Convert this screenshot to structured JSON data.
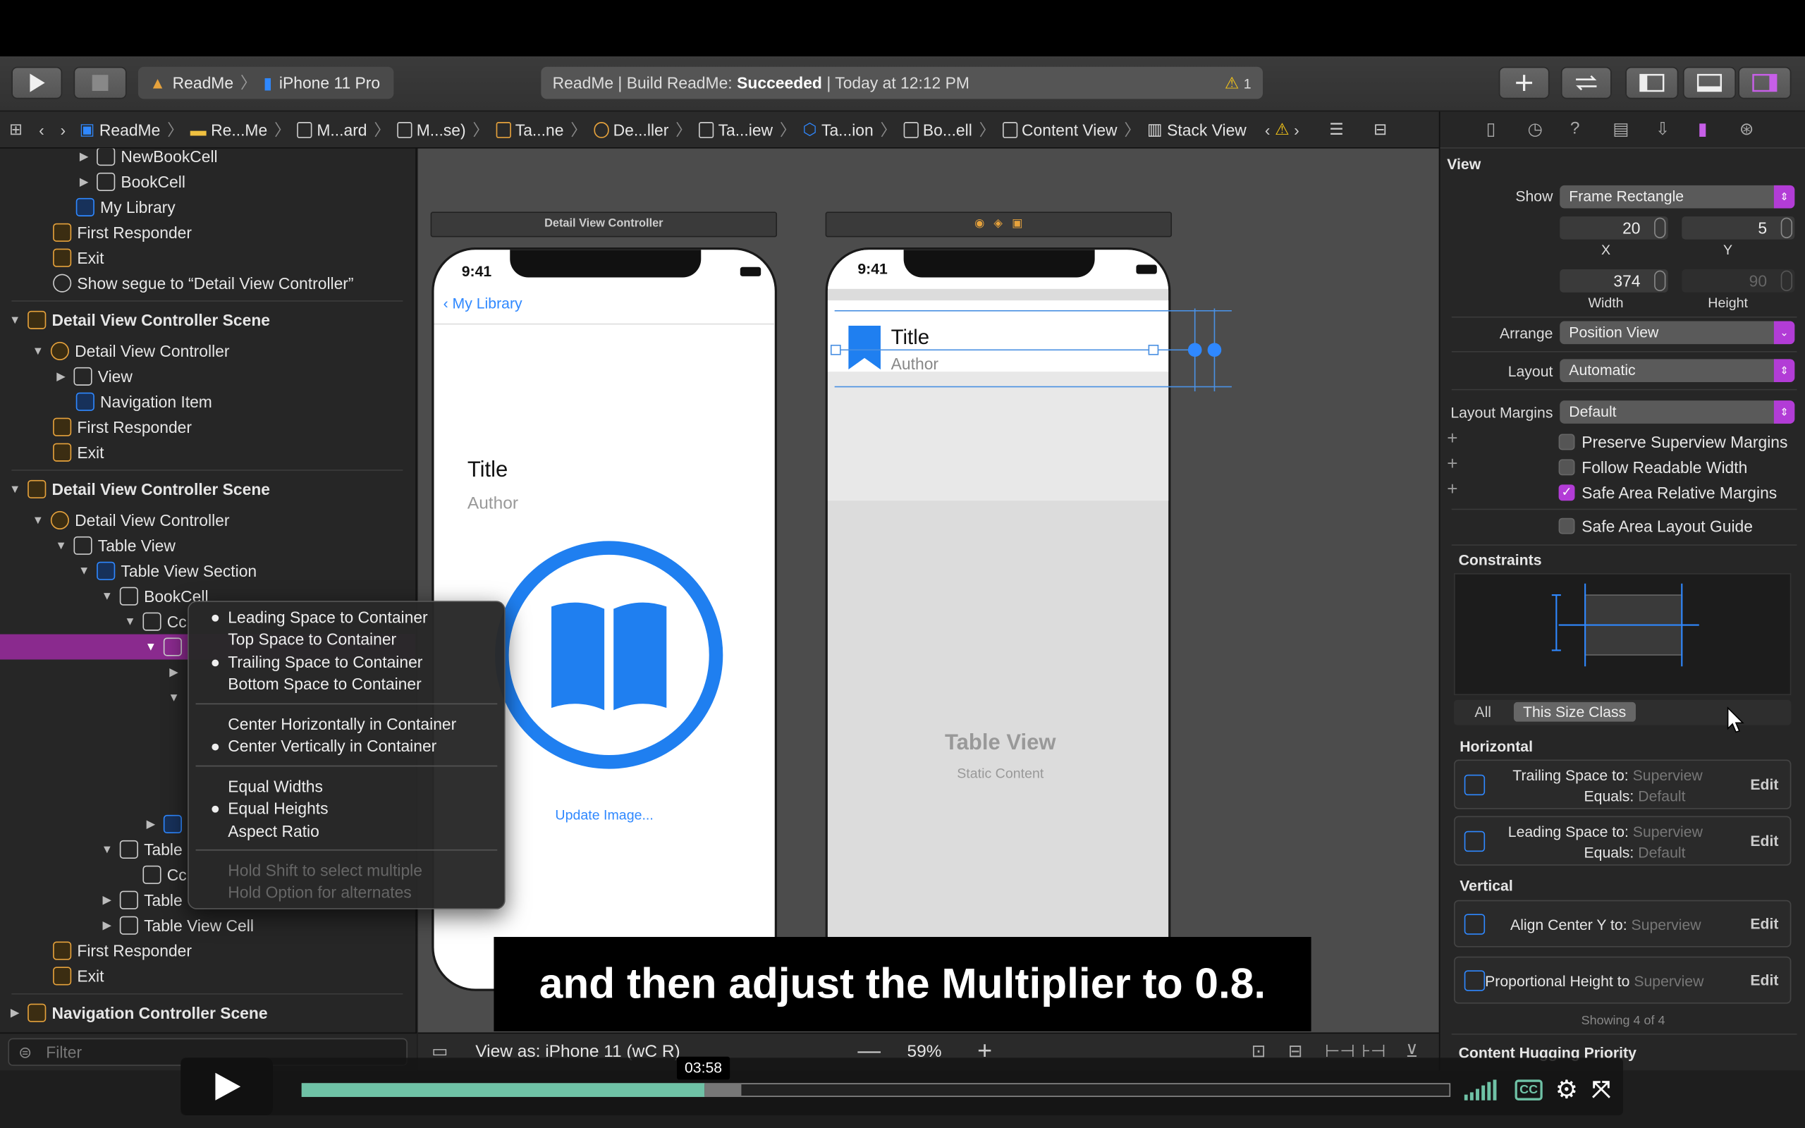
{
  "toolbar": {
    "scheme_app": "ReadMe",
    "scheme_device": "iPhone 11 Pro",
    "status_prefix": "ReadMe | Build ReadMe:",
    "status_result": "Succeeded",
    "status_time": "| Today at 12:12 PM",
    "warning_count": "1"
  },
  "jumpbar": {
    "crumbs": [
      "ReadMe",
      "Re...Me",
      "M...ard",
      "M...se)",
      "Ta...ne",
      "De...ller",
      "Ta...iew",
      "Ta...ion",
      "Bo...ell",
      "Content View",
      "Stack View"
    ]
  },
  "navigator": {
    "rows": [
      "NewBookCell",
      "BookCell",
      "My Library",
      "First Responder",
      "Exit",
      "Show segue to “Detail View Controller”",
      "Detail View Controller Scene",
      "Detail View Controller",
      "View",
      "Navigation Item",
      "First Responder",
      "Exit",
      "Detail View Controller Scene",
      "Detail View Controller",
      "Table View",
      "Table View Section",
      "BookCell",
      "Cc",
      "Table",
      "Cc",
      "Table",
      "Table View Cell",
      "First Responder",
      "Exit",
      "Navigation Controller Scene"
    ],
    "filter_placeholder": "Filter"
  },
  "canvas": {
    "scene1_title": "Detail View Controller",
    "time": "9:41",
    "back_label": "My Library",
    "book_title": "Title",
    "book_author": "Author",
    "update_image": "Update Image...",
    "table_view_title": "Table View",
    "table_view_sub": "Static Content",
    "view_as": "View as: iPhone 11 (wC  R)",
    "zoom": "59%"
  },
  "context_menu": {
    "group1": [
      "Leading Space to Container",
      "Top Space to Container",
      "Trailing Space to Container",
      "Bottom Space to Container"
    ],
    "group2": [
      "Center Horizontally in Container",
      "Center Vertically in Container"
    ],
    "group3": [
      "Equal Widths",
      "Equal Heights",
      "Aspect Ratio"
    ],
    "hints": [
      "Hold Shift to select multiple",
      "Hold Option for alternates"
    ]
  },
  "inspector": {
    "section": "View",
    "show_label": "Show",
    "show_value": "Frame Rectangle",
    "x": "20",
    "y": "5",
    "width": "374",
    "height": "90",
    "x_label": "X",
    "y_label": "Y",
    "width_label": "Width",
    "height_label": "Height",
    "arrange_label": "Arrange",
    "arrange_value": "Position View",
    "layout_label": "Layout",
    "layout_value": "Automatic",
    "margins_label": "Layout Margins",
    "margins_value": "Default",
    "checks": [
      "Preserve Superview Margins",
      "Follow Readable Width",
      "Safe Area Relative Margins",
      "Safe Area Layout Guide"
    ],
    "constraints_hdr": "Constraints",
    "filter_all": "All",
    "filter_size": "This Size Class",
    "horizontal_hdr": "Horizontal",
    "vertical_hdr": "Vertical",
    "c1_a": "Trailing Space to:",
    "c1_b": "Superview",
    "c1_c": "Equals:",
    "c1_d": "Default",
    "c2_a": "Leading Space to:",
    "c2_b": "Superview",
    "c2_c": "Equals:",
    "c2_d": "Default",
    "c3_a": "Align Center Y to:",
    "c3_b": "Superview",
    "c4_a": "Proportional Height to",
    "c4_b": "Superview",
    "edit": "Edit",
    "showing": "Showing 4 of 4",
    "hugging": "Content Hugging Priority"
  },
  "video": {
    "caption": "and then adjust the Multiplier to 0.8.",
    "timestamp": "03:58",
    "progress": 0.351,
    "cc_label": "CC"
  }
}
